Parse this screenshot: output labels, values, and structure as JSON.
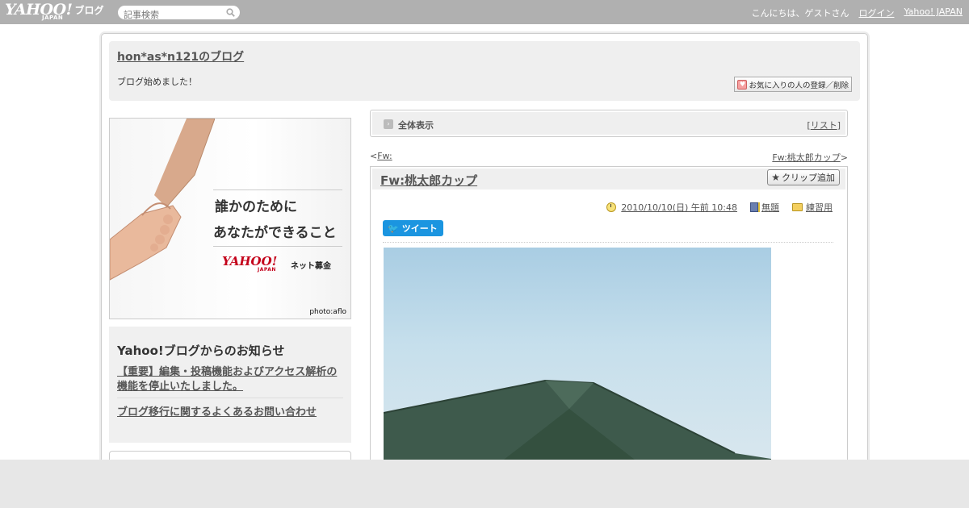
{
  "topbar": {
    "logo_text": "YAHOO!",
    "logo_sub": "JAPAN",
    "logo_service": "ブログ",
    "search_placeholder": "記事検索",
    "greeting": "こんにちは、ゲストさん",
    "login_label": "ログイン",
    "yahoo_japan_label": "Yahoo! JAPAN"
  },
  "header": {
    "blog_title": "hon*as*n121のブログ",
    "description": "ブログ始めました！",
    "favorite_button_label": "お気に入りの人の登録／削除"
  },
  "banner": {
    "line1": "誰かのために",
    "line2": "あなたができること",
    "brand": "YAHOO!",
    "brand_sub": "JAPAN",
    "brand_service": "ネット募金",
    "credit": "photo:aflo"
  },
  "notice": {
    "title": "Yahoo!ブログからのお知らせ",
    "items": [
      {
        "label": "【重要】編集・投稿機能およびアクセス解析の機能を停止いたしました。"
      },
      {
        "label": "ブログ移行に関するよくあるお問い合わせ"
      }
    ]
  },
  "viewbar": {
    "label": "全体表示",
    "list_open": "[",
    "list_label": "リスト",
    "list_close": "]"
  },
  "pager": {
    "prev_arrow": "<",
    "prev_label": "Fw:",
    "next_label": "Fw:桃太郎カップ",
    "next_arrow": ">"
  },
  "article": {
    "title": "Fw:桃太郎カップ",
    "clip_button_label": "クリップ追加",
    "datetime": "2010/10/10(日) 午前 10:48",
    "category_label": "無題",
    "folder_label": "練習用",
    "tweet_label": "ツイート"
  },
  "icons": {
    "search": "search-icon",
    "star": "star-icon",
    "clock": "clock-icon",
    "book": "book-icon",
    "folder": "folder-icon",
    "twitter": "twitter-bird-icon",
    "heart": "heart-icon"
  },
  "colors": {
    "topbar_bg": "#b0b0b0",
    "panel_bg": "#efefef",
    "tweet_blue": "#1b95e0",
    "yahoo_red": "#c4001a",
    "tent_green": "#3e5a4c"
  }
}
